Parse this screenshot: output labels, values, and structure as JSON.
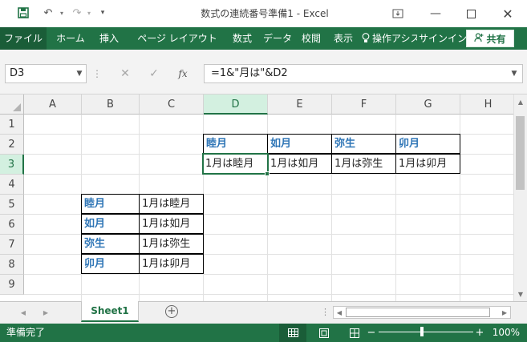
{
  "window": {
    "title": "数式の連続番号準備1 - Excel",
    "icons": [
      "save-icon",
      "undo-icon",
      "redo-icon",
      "customize-qat-icon",
      "ribbon-display-icon",
      "minimize-icon",
      "maximize-icon",
      "close-icon"
    ]
  },
  "ribbon": {
    "tabs": [
      "ファイル",
      "ホーム",
      "挿入",
      "ページ レイアウト",
      "数式",
      "データ",
      "校閲",
      "表示"
    ],
    "tell_me": "操作アシス",
    "signin": "サインイン",
    "share": "共有"
  },
  "formula_bar": {
    "name_box": "D3",
    "formula": "=1&\"月は\"&D2",
    "fx": "fx"
  },
  "sheet": {
    "columns": [
      "A",
      "B",
      "C",
      "D",
      "E",
      "F",
      "G",
      "H"
    ],
    "rows": [
      "1",
      "2",
      "3",
      "4",
      "5",
      "6",
      "7",
      "8",
      "9"
    ],
    "active_cell": "D3",
    "row2": [
      "睦月",
      "如月",
      "弥生",
      "卯月"
    ],
    "row3": [
      "1月は睦月",
      "1月は如月",
      "1月は弥生",
      "1月は卯月"
    ],
    "table": [
      [
        "睦月",
        "1月は睦月"
      ],
      [
        "如月",
        "1月は如月"
      ],
      [
        "弥生",
        "1月は弥生"
      ],
      [
        "卯月",
        "1月は卯月"
      ]
    ]
  },
  "tabs": {
    "sheet_name": "Sheet1",
    "add_sheet": "+"
  },
  "status": {
    "ready": "準備完了",
    "zoom": "100%",
    "minus": "−",
    "plus": "+"
  },
  "colors": {
    "accent": "#217346",
    "header_text": "#2e75b6"
  }
}
